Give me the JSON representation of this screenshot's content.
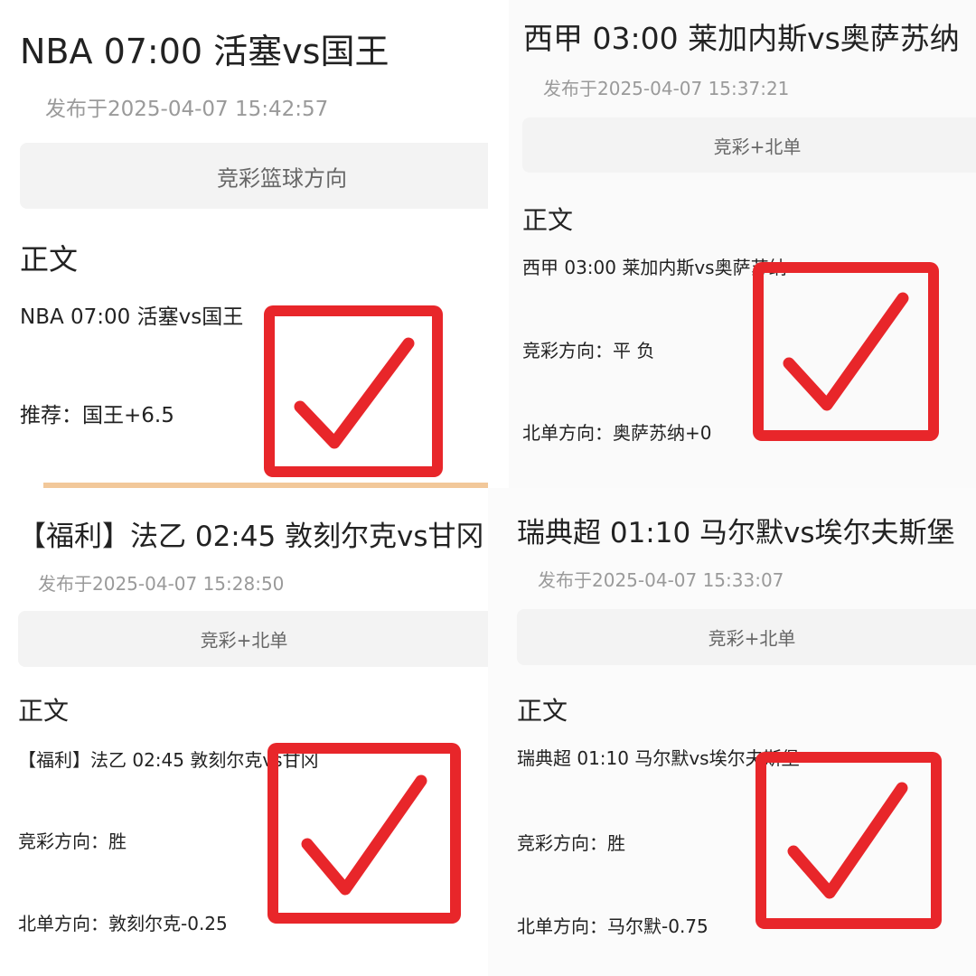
{
  "colors": {
    "check_red": "#e8262a",
    "date_gray": "#9a9a9a",
    "button_bg": "#f3f3f3"
  },
  "panels": [
    {
      "title": "NBA 07:00 活塞vs国王",
      "date": "发布于2025-04-07 15:42:57",
      "category": "竞彩篮球方向",
      "section": "正文",
      "lines": [
        "NBA  07:00  活塞vs国王",
        "推荐：国王+6.5"
      ]
    },
    {
      "title": "西甲 03:00 莱加内斯vs奥萨苏纳",
      "date": "发布于2025-04-07 15:37:21",
      "category": "竞彩+北单",
      "section": "正文",
      "lines": [
        "西甲  03:00  莱加内斯vs奥萨苏纳",
        "竞彩方向：平  负",
        "北单方向：奥萨苏纳+0"
      ]
    },
    {
      "title": "【福利】法乙 02:45 敦刻尔克vs甘冈",
      "date": "发布于2025-04-07 15:28:50",
      "category": "竞彩+北单",
      "section": "正文",
      "lines": [
        "【福利】法乙 02:45  敦刻尔克vs甘冈",
        "竞彩方向：胜",
        "北单方向：敦刻尔克-0.25"
      ]
    },
    {
      "title": "瑞典超 01:10 马尔默vs埃尔夫斯堡",
      "date": "发布于2025-04-07 15:33:07",
      "category": "竞彩+北单",
      "section": "正文",
      "lines": [
        "瑞典超  01:10  马尔默vs埃尔夫斯堡",
        "竞彩方向：胜",
        "北单方向：马尔默-0.75"
      ]
    }
  ],
  "icons": {
    "result_mark": "check-mark-icon"
  }
}
